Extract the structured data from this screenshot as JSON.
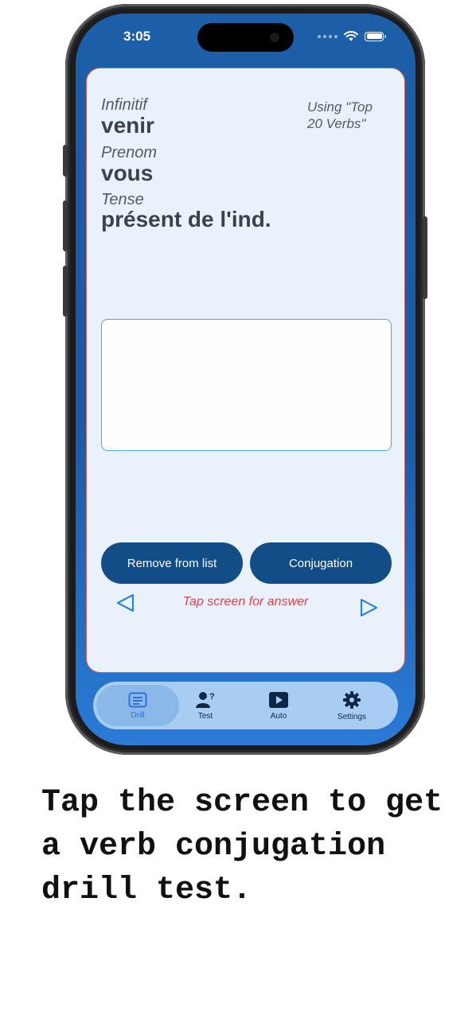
{
  "status": {
    "time": "3:05"
  },
  "drill": {
    "infinitive_label": "Infinitif",
    "infinitive_value": "venir",
    "pronoun_label": "Prenom",
    "pronoun_value": "vous",
    "tense_label": "Tense",
    "tense_value": "présent de l'ind.",
    "list_info": "Using \"Top 20 Verbs\"",
    "answer": "",
    "remove_button": "Remove from list",
    "conjugation_button": "Conjugation",
    "hint": "Tap screen for answer"
  },
  "tabs": [
    {
      "label": "Drill",
      "icon": "list-card-icon",
      "active": true
    },
    {
      "label": "Test",
      "icon": "person-question-icon",
      "active": false
    },
    {
      "label": "Auto",
      "icon": "play-icon",
      "active": false
    },
    {
      "label": "Settings",
      "icon": "gear-icon",
      "active": false
    }
  ],
  "caption": "Tap the screen to get a verb conjugation drill test.",
  "colors": {
    "accent": "#124d87",
    "hint": "#e2434d",
    "card": "#e9f1fb",
    "screen_bg": "#1d5ea8"
  }
}
